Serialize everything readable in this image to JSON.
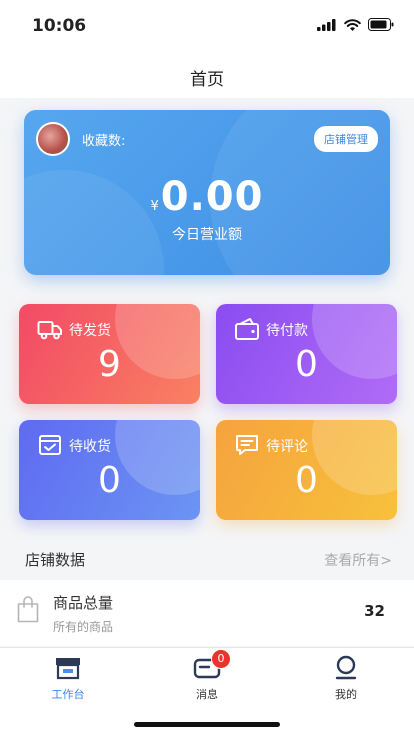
{
  "status": {
    "time": "10:06"
  },
  "nav": {
    "title": "首页"
  },
  "hero": {
    "favorites_label": "收藏数:",
    "shop_manage_button": "店铺管理",
    "currency": "¥",
    "amount": "0.00",
    "amount_label": "今日营业额"
  },
  "cards": [
    {
      "title": "待发货",
      "count": "9",
      "icon": "truck-icon"
    },
    {
      "title": "待付款",
      "count": "0",
      "icon": "wallet-icon"
    },
    {
      "title": "待收货",
      "count": "0",
      "icon": "receive-box-icon"
    },
    {
      "title": "待评论",
      "count": "0",
      "icon": "comment-icon"
    }
  ],
  "section": {
    "title": "店铺数据",
    "more_link": "查看所有>"
  },
  "stats": [
    {
      "title": "商品总量",
      "subtitle": "所有的商品",
      "value": "32",
      "icon": "shopping-bag-icon"
    }
  ],
  "tabs": [
    {
      "label": "工作台",
      "icon": "store-icon",
      "active": true
    },
    {
      "label": "消息",
      "icon": "message-icon",
      "badge": "0"
    },
    {
      "label": "我的",
      "icon": "profile-icon"
    }
  ],
  "colors": {
    "accent": "#3e86e6",
    "badge": "#e8352b"
  }
}
